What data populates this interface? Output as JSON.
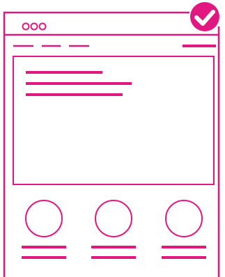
{
  "illustration": {
    "subject": "browser-window-wireframe",
    "accent_color": "#E0187F",
    "background_color": "#FFFFFF",
    "badge_icon": "checkmark-icon",
    "window_control_icons": [
      "window-dot-icon",
      "window-dot-icon",
      "window-dot-icon"
    ],
    "nav_link_count": 3,
    "card_count": 3
  }
}
